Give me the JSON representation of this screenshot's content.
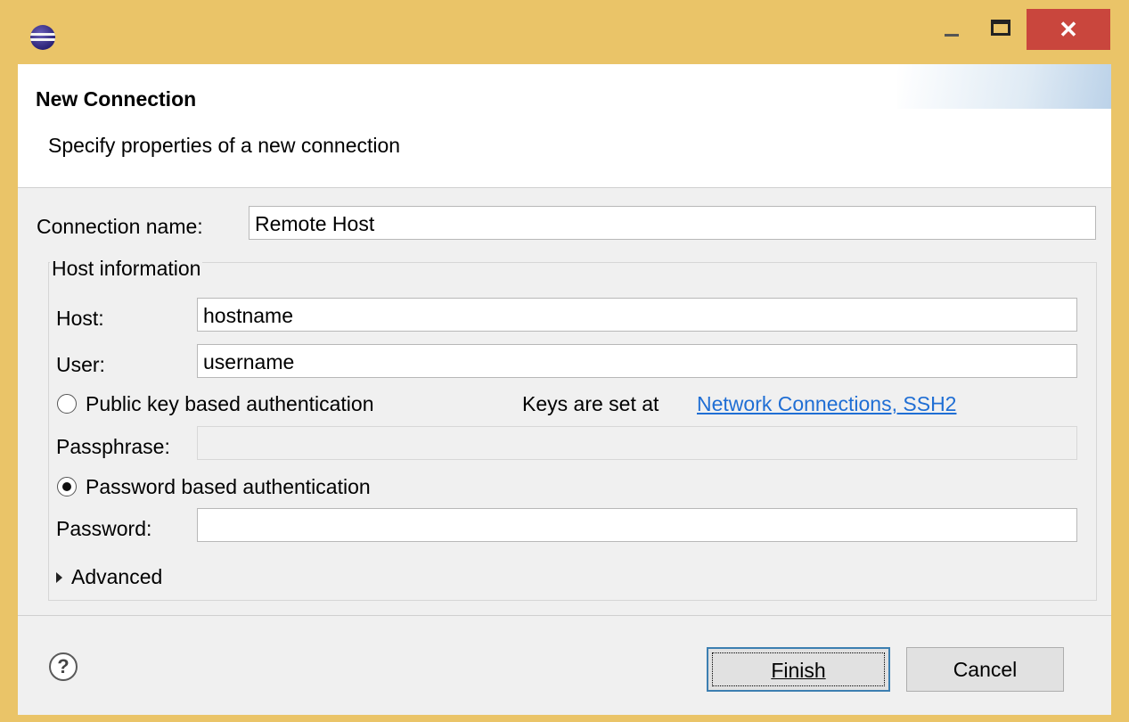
{
  "window": {
    "app_icon": "eclipse-icon",
    "controls": [
      "minimize",
      "maximize",
      "close"
    ],
    "close_glyph": "✕"
  },
  "header": {
    "title": "New Connection",
    "subtitle": "Specify properties of a new connection"
  },
  "form": {
    "connection_name_label": "Connection name:",
    "connection_name_value": "Remote Host",
    "group_label": "Host information",
    "host_label": "Host:",
    "host_value": "hostname",
    "user_label": "User:",
    "user_value": "username",
    "public_key_label": "Public key based authentication",
    "public_key_selected": false,
    "keys_note": "Keys are set at",
    "keys_link": "Network Connections, SSH2",
    "passphrase_label": "Passphrase:",
    "passphrase_value": "",
    "password_auth_label": "Password based authentication",
    "password_auth_selected": true,
    "password_label": "Password:",
    "password_value": "",
    "advanced_label": "Advanced"
  },
  "footer": {
    "help_glyph": "?",
    "finish_label": "Finish",
    "cancel_label": "Cancel"
  },
  "colors": {
    "title_bar": "#eac468",
    "close_button": "#c9463d",
    "link": "#1f6ed4",
    "default_button_border": "#3c7fb1"
  }
}
